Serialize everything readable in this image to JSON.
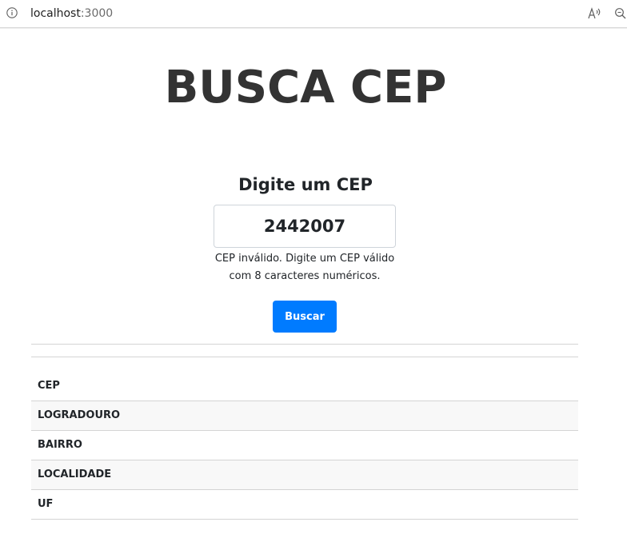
{
  "browser": {
    "url_host": "localhost",
    "url_port": ":3000"
  },
  "page": {
    "title": "BUSCA CEP",
    "subtitle": "Digite um CEP",
    "cep_input_value": "2442007",
    "error_line1": "CEP inválido. Digite um CEP válido",
    "error_line2": "com 8 caracteres numéricos.",
    "search_button_label": "Buscar"
  },
  "results": {
    "rows": [
      {
        "label": "CEP"
      },
      {
        "label": "LOGRADOURO"
      },
      {
        "label": "BAIRRO"
      },
      {
        "label": "LOCALIDADE"
      },
      {
        "label": "UF"
      }
    ]
  },
  "colors": {
    "accent": "#007bff",
    "title": "#333333"
  },
  "icons": {
    "info": "info-icon",
    "read_aloud": "read-aloud-icon",
    "zoom": "zoom-icon"
  }
}
